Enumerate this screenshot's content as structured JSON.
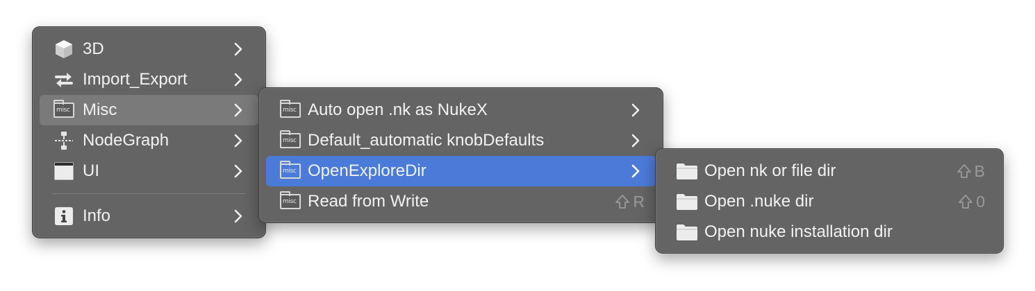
{
  "menu1": {
    "items": [
      {
        "label": "3D",
        "icon": "cube-icon",
        "submenu": true
      },
      {
        "label": "Import_Export",
        "icon": "swap-arrows-icon",
        "submenu": true
      },
      {
        "label": "Misc",
        "icon": "misc-folder-icon",
        "submenu": true,
        "highlighted": true
      },
      {
        "label": "NodeGraph",
        "icon": "nodegraph-icon",
        "submenu": true
      },
      {
        "label": "UI",
        "icon": "window-icon",
        "submenu": true
      },
      {
        "label": "Info",
        "icon": "info-icon",
        "submenu": true
      }
    ],
    "misc_icon_text": "misc"
  },
  "menu2": {
    "items": [
      {
        "label": "Auto open .nk as NukeX",
        "icon": "misc-folder-icon",
        "submenu": true
      },
      {
        "label": "Default_automatic knobDefaults",
        "icon": "misc-folder-icon",
        "submenu": true
      },
      {
        "label": "OpenExploreDir",
        "icon": "misc-folder-icon",
        "submenu": true,
        "selected": true
      },
      {
        "label": "Read from Write",
        "icon": "misc-folder-icon",
        "shortcut_key": "R"
      }
    ]
  },
  "menu3": {
    "items": [
      {
        "label": "Open nk or file dir",
        "icon": "folder-icon",
        "shortcut_key": "B"
      },
      {
        "label": "Open .nuke dir",
        "icon": "folder-icon",
        "shortcut_key": "0"
      },
      {
        "label": "Open nuke installation dir",
        "icon": "folder-icon"
      }
    ]
  },
  "colors": {
    "menu_bg": "#646464",
    "highlight_gray": "#7a7a7a",
    "selection_blue": "#4b7bd8",
    "text": "#f2f2f2",
    "shortcut_text": "#9a9a9a"
  }
}
